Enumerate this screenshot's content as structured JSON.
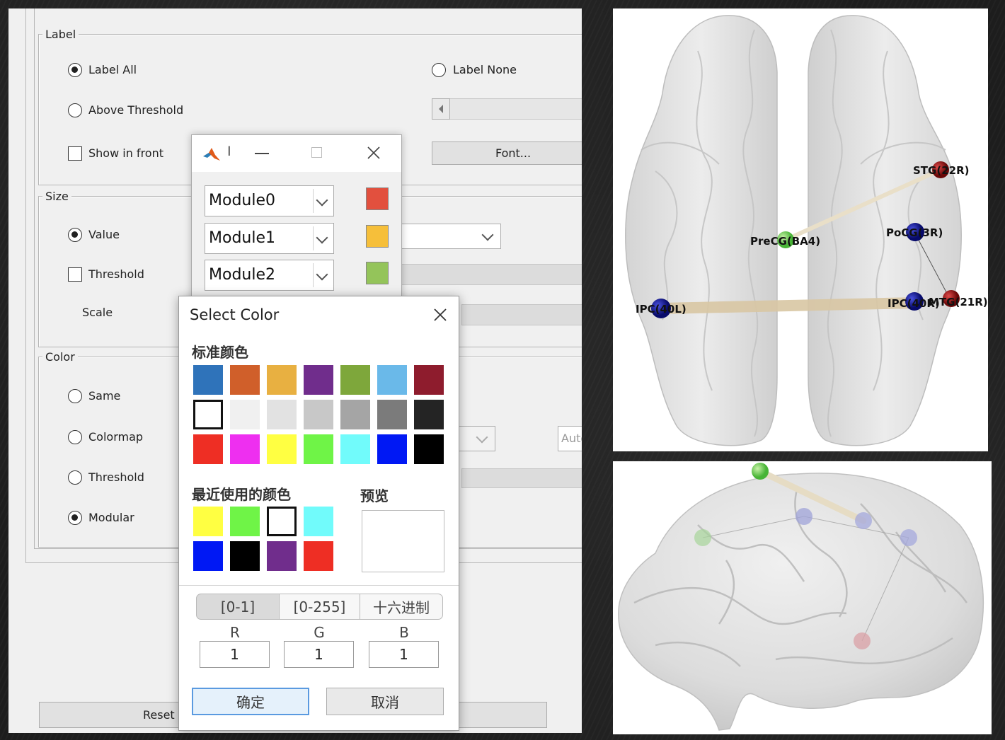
{
  "panel": {
    "label_group": {
      "title": "Label",
      "label_all": "Label All",
      "label_none": "Label None",
      "above_threshold": "Above Threshold",
      "show_in_front": "Show in front",
      "font_button": "Font..."
    },
    "size_group": {
      "title": "Size",
      "value": "Value",
      "threshold": "Threshold",
      "scale": "Scale"
    },
    "color_group": {
      "title": "Color",
      "same": "Same",
      "colormap": "Colormap",
      "threshold": "Threshold",
      "modular": "Modular",
      "auto_partial": "Auto"
    },
    "reset_button": "Reset",
    "selected": {
      "label": "label_all",
      "size": "value",
      "color": "modular"
    }
  },
  "module_dialog": {
    "title_partial": "I",
    "modules": [
      {
        "name": "Module0",
        "color": "#e2503e"
      },
      {
        "name": "Module1",
        "color": "#f6bf3a"
      },
      {
        "name": "Module2",
        "color": "#94c45a"
      }
    ]
  },
  "color_dialog": {
    "title": "Select Color",
    "standard_heading": "标准颜色",
    "recent_heading": "最近使用的颜色",
    "preview_heading": "预览",
    "standard_colors": [
      [
        "#2f73ba",
        "#d05f2a",
        "#e8b041",
        "#702d8c",
        "#7ea73b",
        "#6ab9e9",
        "#8e1c2d"
      ],
      [
        "#ffffff",
        "#f0f0f0",
        "#e2e2e2",
        "#c8c8c8",
        "#a5a5a5",
        "#7b7b7b",
        "#242424"
      ],
      [
        "#ee2e24",
        "#ee2ff0",
        "#ffff42",
        "#6ff447",
        "#71fbfb",
        "#0018f4",
        "#000000"
      ]
    ],
    "selected_standard": [
      1,
      0
    ],
    "recent_colors": [
      [
        "#ffff42",
        "#6ff447",
        "#ffffff",
        "#71fbfb"
      ],
      [
        "#0018f4",
        "#000000",
        "#702d8c",
        "#ee2e24"
      ]
    ],
    "selected_recent": [
      0,
      2
    ],
    "preview_color": "#ffffff",
    "modes": [
      "[0-1]",
      "[0-255]",
      "十六进制"
    ],
    "active_mode": 0,
    "rgb_labels": [
      "R",
      "G",
      "B"
    ],
    "rgb_values": [
      "1",
      "1",
      "1"
    ],
    "ok": "确定",
    "cancel": "取消"
  },
  "brain_top": {
    "nodes": [
      {
        "label": "STG(22R)",
        "color": "#8b1010"
      },
      {
        "label": "PreCG(BA4)",
        "color": "#58cc44"
      },
      {
        "label": "PoCG(3R)",
        "color": "#10148c"
      },
      {
        "label": "IPC(40L)",
        "color": "#10148c"
      },
      {
        "label": "IPC(40R)",
        "color": "#10148c"
      },
      {
        "label": "MTG(21R)",
        "color": "#8b1010"
      }
    ]
  }
}
